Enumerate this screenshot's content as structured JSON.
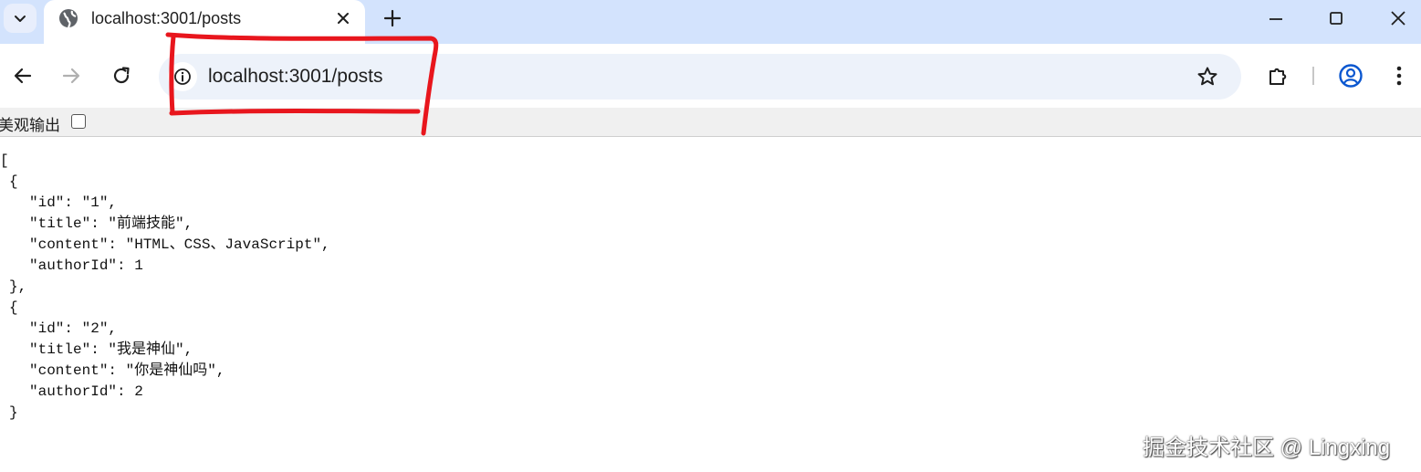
{
  "tab": {
    "title": "localhost:3001/posts",
    "favicon": "globe-icon"
  },
  "address_bar": {
    "url": "localhost:3001/posts"
  },
  "json_viewer": {
    "pretty_print_label": "美观输出",
    "pretty_print_checked": false,
    "lines": [
      {
        "indent": 0,
        "text": "["
      },
      {
        "indent": 1,
        "text": "{"
      },
      {
        "indent": 2,
        "text": "\"id\": \"1\","
      },
      {
        "indent": 2,
        "text": "\"title\": \"前端技能\","
      },
      {
        "indent": 2,
        "text": "\"content\": \"HTML、CSS、JavaScript\","
      },
      {
        "indent": 2,
        "text": "\"authorId\": 1"
      },
      {
        "indent": 1,
        "text": "},"
      },
      {
        "indent": 1,
        "text": "{"
      },
      {
        "indent": 2,
        "text": "\"id\": \"2\","
      },
      {
        "indent": 2,
        "text": "\"title\": \"我是神仙\","
      },
      {
        "indent": 2,
        "text": "\"content\": \"你是神仙吗\","
      },
      {
        "indent": 2,
        "text": "\"authorId\": 2"
      },
      {
        "indent": 1,
        "text": "}"
      }
    ]
  },
  "watermark": "掘金技术社区 @ Lingxing",
  "colors": {
    "tabstrip": "#d3e3fd",
    "omnibox": "#edf2fa",
    "annotation": "#e8161d",
    "accent": "#0b57d0"
  }
}
